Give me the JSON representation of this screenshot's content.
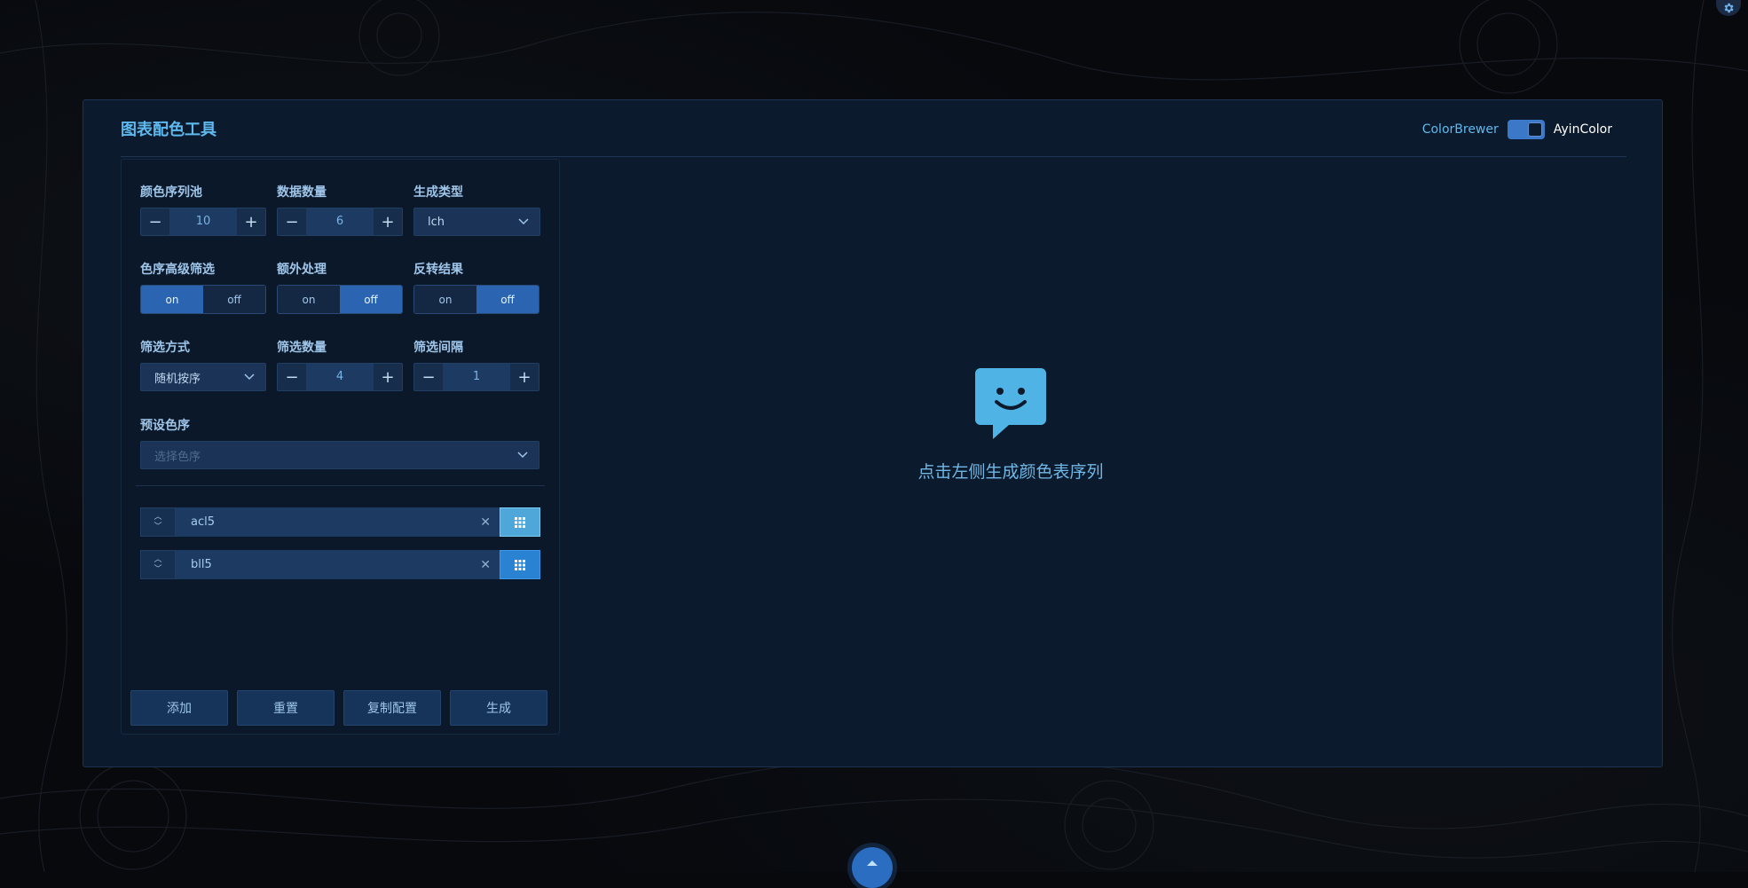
{
  "header": {
    "title": "图表配色工具",
    "switch_left": "ColorBrewer",
    "switch_right": "AyinColor"
  },
  "controls": {
    "pool": {
      "label": "颜色序列池",
      "value": "10"
    },
    "count": {
      "label": "数据数量",
      "value": "6"
    },
    "gen_type": {
      "label": "生成类型",
      "value": "lch"
    },
    "advanced_filter": {
      "label": "色序高级筛选",
      "on": "on",
      "off": "off",
      "selected": "on"
    },
    "extra": {
      "label": "额外处理",
      "on": "on",
      "off": "off",
      "selected": "off"
    },
    "reverse": {
      "label": "反转结果",
      "on": "on",
      "off": "off",
      "selected": "off"
    },
    "filter_method": {
      "label": "筛选方式",
      "value": "随机按序"
    },
    "filter_count": {
      "label": "筛选数量",
      "value": "4"
    },
    "filter_interval": {
      "label": "筛选间隔",
      "value": "1"
    },
    "preset": {
      "label": "预设色序",
      "placeholder": "选择色序"
    }
  },
  "sequences": [
    {
      "name": "acl5"
    },
    {
      "name": "bll5"
    }
  ],
  "buttons": {
    "add": "添加",
    "reset": "重置",
    "copy": "复制配置",
    "generate": "生成"
  },
  "empty_state": {
    "text": "点击左侧生成颜色表序列"
  },
  "colors": {
    "accent": "#5eb9ee",
    "active": "#2b64b0",
    "panel": "#0c1a2e"
  }
}
